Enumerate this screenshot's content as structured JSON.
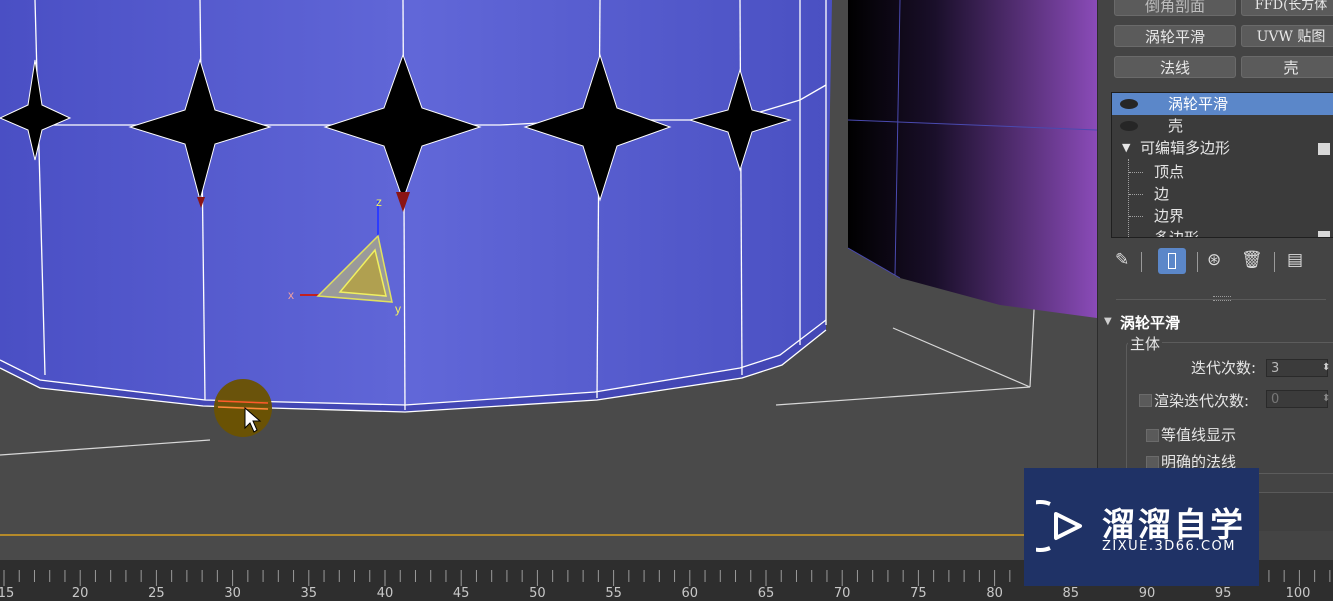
{
  "modifier_buttons": [
    {
      "label": "倒角剖面"
    },
    {
      "label": "FFD(长方体"
    },
    {
      "label": "涡轮平滑"
    },
    {
      "label": "UVW 贴图"
    },
    {
      "label": "法线"
    },
    {
      "label": "壳"
    }
  ],
  "stack": {
    "items": [
      {
        "label": "涡轮平滑",
        "selected": true
      },
      {
        "label": "壳",
        "selected": false
      },
      {
        "label": "可编辑多边形",
        "selected": false
      }
    ],
    "subobjects": [
      "顶点",
      "边",
      "边界",
      "多边形"
    ]
  },
  "toolbar": {
    "icons": [
      "pin-icon",
      "show-end-result-icon",
      "make-unique-icon",
      "remove-modifier-icon",
      "configure-modifier-sets-icon"
    ]
  },
  "rollout": {
    "title": "涡轮平滑",
    "group": "主体",
    "iterations_label": "迭代次数:",
    "iterations_value": "3",
    "render_iters_label": "渲染迭代次数:",
    "render_iters_value": "0",
    "isoline_label": "等值线显示",
    "explicit_normals_label": "明确的法线"
  },
  "viewport": {
    "gizmo_axes": [
      "x",
      "y",
      "z"
    ],
    "cursor_highlight_color": "#6b5200",
    "object_color": "#5258cc"
  },
  "timeline": {
    "ticks": [
      "15",
      "20",
      "25",
      "30",
      "35",
      "40",
      "45",
      "50",
      "55",
      "60",
      "65",
      "70",
      "75",
      "80",
      "85",
      "90",
      "95",
      "100"
    ]
  },
  "watermark": {
    "title": "溜溜自学",
    "subtitle": "ZIXUE.3D66.COM"
  }
}
